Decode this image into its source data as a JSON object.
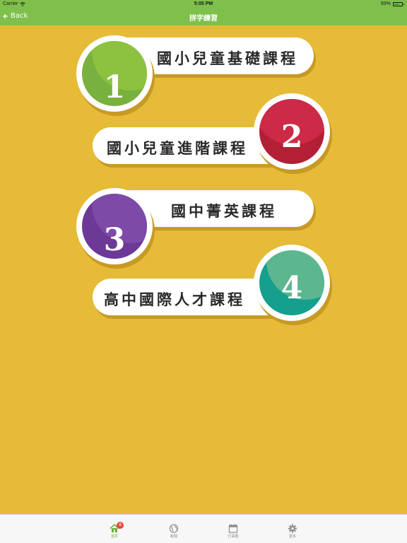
{
  "status_bar": {
    "carrier": "Carrier",
    "time": "5:05 PM",
    "battery": "69%",
    "battery_level": 0.69
  },
  "nav": {
    "back_label": "Back",
    "title": "拼字練習"
  },
  "courses": [
    {
      "label": "國小兒童基礎課程",
      "number": "1",
      "color": "#79b13e",
      "shine": "#8cc23f"
    },
    {
      "label": "國小兒童進階課程",
      "number": "2",
      "color": "#b31f35",
      "shine": "#cc2a47"
    },
    {
      "label": "國中菁英課程",
      "number": "3",
      "color": "#6c3996",
      "shine": "#7d4aa8"
    },
    {
      "label": "高中國際人才課程",
      "number": "4",
      "color": "#14a08c",
      "shine": "#5cb690"
    }
  ],
  "tabs": [
    {
      "label": "首頁",
      "icon": "home-icon",
      "badge": "8"
    },
    {
      "label": "新聞",
      "icon": "globe-icon"
    },
    {
      "label": "行事曆",
      "icon": "calendar-icon"
    },
    {
      "label": "更多",
      "icon": "gear-icon"
    }
  ],
  "colors": {
    "background": "#e5bb38",
    "bar": "#7fc04c",
    "tab_active": "#6db33f"
  }
}
